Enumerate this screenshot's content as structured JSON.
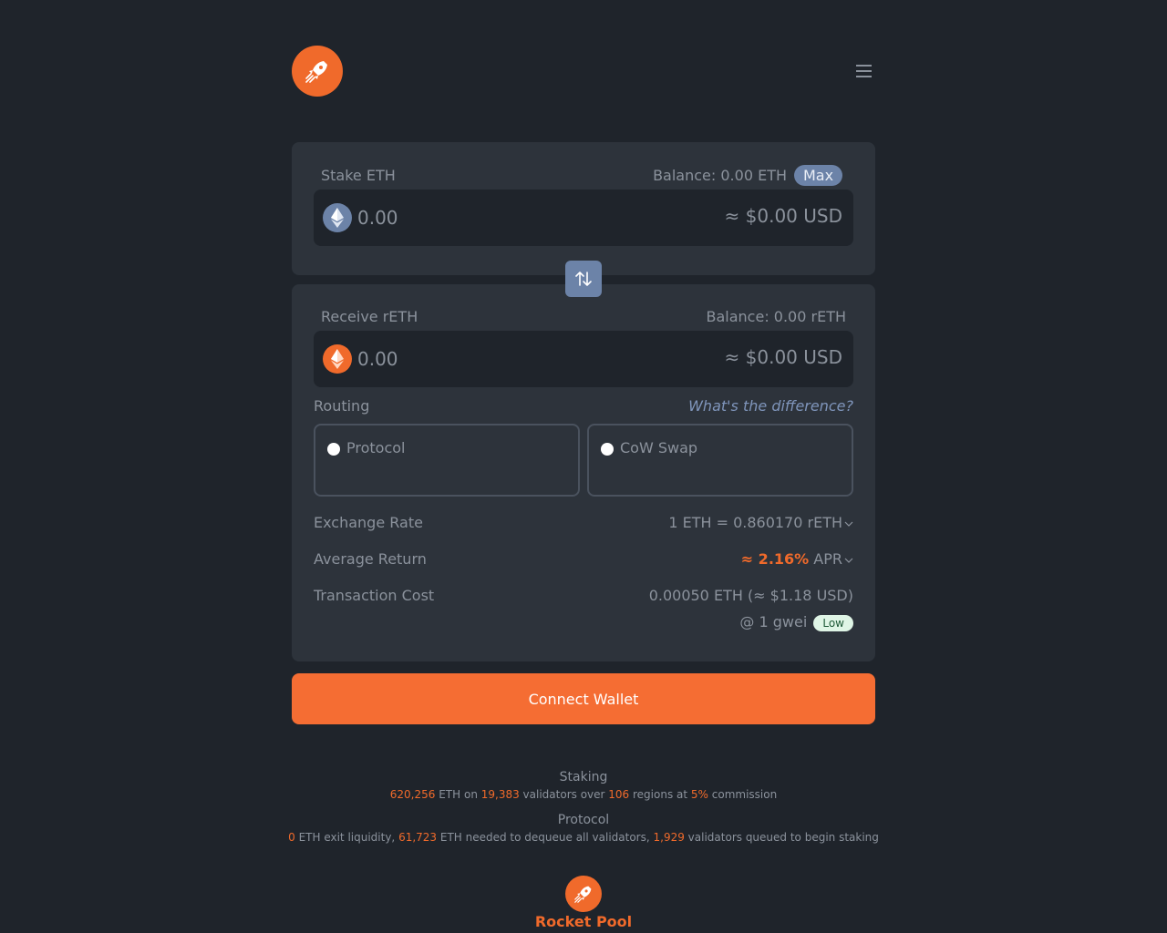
{
  "header": {
    "logo_icon": "rocket-logo-icon",
    "menu_icon": "hamburger-menu-icon"
  },
  "stake": {
    "label": "Stake ETH",
    "balance": "Balance: 0.00 ETH",
    "max_label": "Max",
    "amount_placeholder": "0.00",
    "usd": "≈ $0.00 USD",
    "token_icon": "eth-icon"
  },
  "swap_icon": "swap-arrows-icon",
  "receive": {
    "label": "Receive rETH",
    "balance": "Balance: 0.00 rETH",
    "amount_placeholder": "0.00",
    "usd": "≈ $0.00 USD",
    "token_icon": "reth-icon"
  },
  "routing": {
    "label": "Routing",
    "link": "What's the difference?",
    "options": [
      {
        "name": "Protocol"
      },
      {
        "name": "CoW Swap"
      }
    ]
  },
  "details": {
    "exchange_rate_label": "Exchange Rate",
    "exchange_rate_value": "1 ETH = 0.860170 rETH",
    "average_return_label": "Average Return",
    "average_return_value": "≈ 2.16%",
    "average_return_unit": "APR",
    "transaction_cost_label": "Transaction Cost",
    "transaction_cost_value": "0.00050 ETH (≈ $1.18 USD)",
    "gas_price": "@ 1 gwei",
    "gas_badge": "Low"
  },
  "connect_label": "Connect Wallet",
  "stats": {
    "staking_title": "Staking",
    "staking": {
      "eth": "620,256",
      "t1": " ETH on ",
      "validators": "19,383",
      "t2": " validators over ",
      "regions": "106",
      "t3": " regions at ",
      "commission": "5%",
      "t4": " commission"
    },
    "protocol_title": "Protocol",
    "protocol": {
      "exit_liquidity": "0",
      "t1": " ETH exit liquidity, ",
      "dequeue": "61,723",
      "t2": " ETH needed to dequeue all validators, ",
      "queued": "1,929",
      "t3": " validators queued to begin staking"
    }
  },
  "footer": {
    "brand": "Rocket Pool"
  },
  "colors": {
    "accent": "#f06a2b",
    "background": "#1f242b",
    "card": "#2d333b",
    "eth_blue": "#6c83a8"
  }
}
